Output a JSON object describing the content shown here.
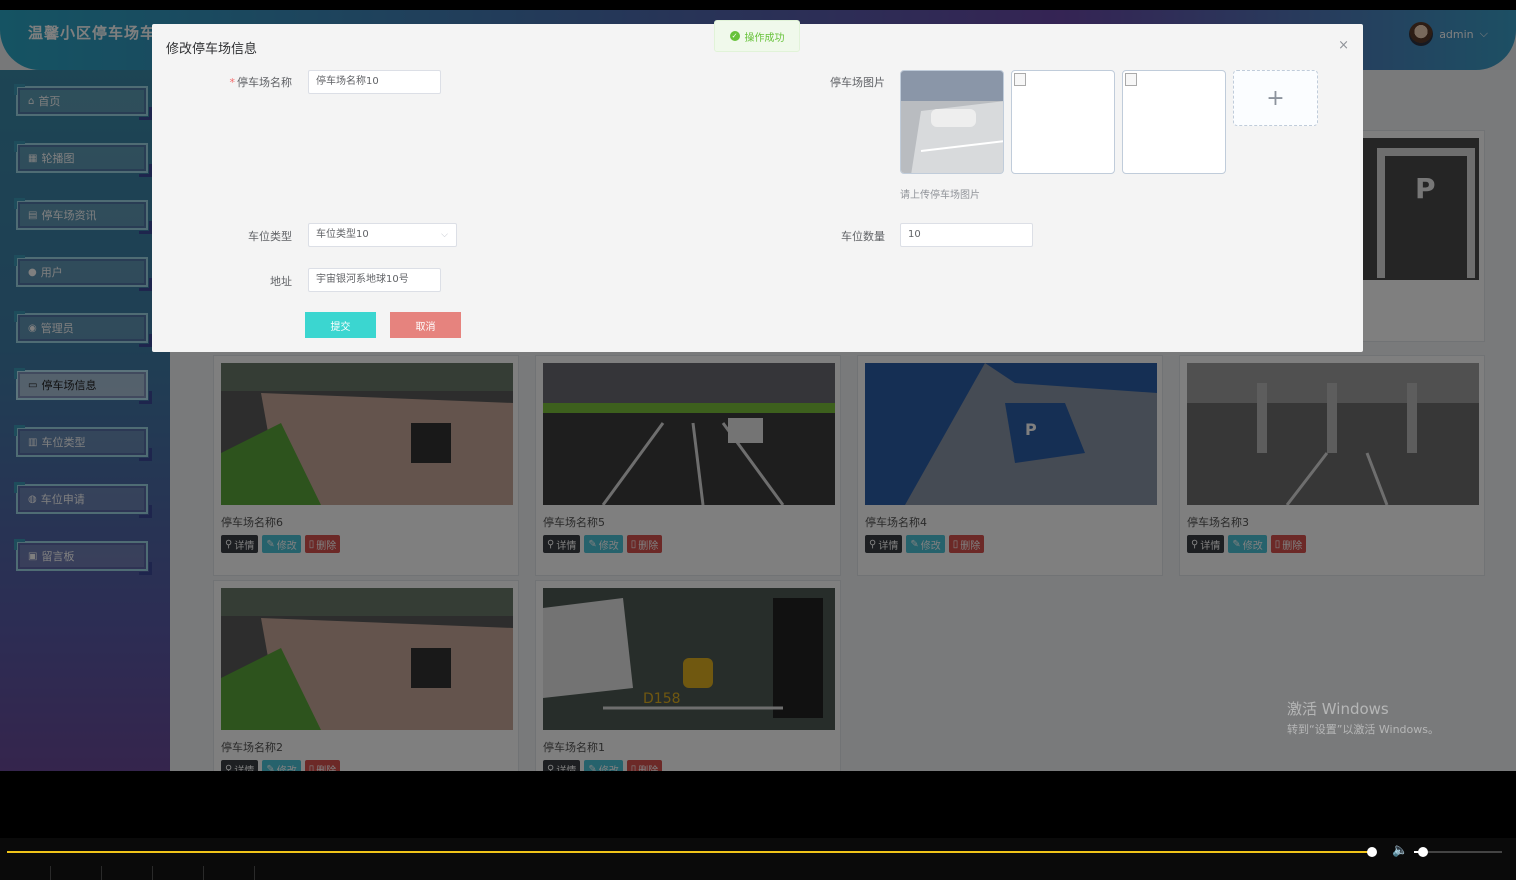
{
  "header": {
    "site_title": "温馨小区停车场车",
    "username": "admin",
    "dropdown_glyph": "⌵"
  },
  "sidebar": {
    "items": [
      {
        "label": "首页",
        "icon": "⌂"
      },
      {
        "label": "轮播图",
        "icon": "▦"
      },
      {
        "label": "停车场资讯",
        "icon": "▤"
      },
      {
        "label": "用户",
        "icon": "●"
      },
      {
        "label": "管理员",
        "icon": "◉"
      },
      {
        "label": "停车场信息",
        "icon": "▭"
      },
      {
        "label": "车位类型",
        "icon": "▥"
      },
      {
        "label": "车位申请",
        "icon": "◍"
      },
      {
        "label": "留言板",
        "icon": "▣"
      }
    ]
  },
  "cards": [
    {
      "name": "停车场名称6"
    },
    {
      "name": "停车场名称5"
    },
    {
      "name": "停车场名称4"
    },
    {
      "name": "停车场名称3"
    },
    {
      "name": "停车场名称2"
    },
    {
      "name": "停车场名称1"
    }
  ],
  "card_actions": {
    "detail": "详情",
    "edit": "修改",
    "delete": "删除"
  },
  "dialog": {
    "title": "修改停车场信息",
    "close_glyph": "×",
    "fields": {
      "name": {
        "label": "停车场名称",
        "value": "停车场名称10"
      },
      "images": {
        "label": "停车场图片",
        "tip": "请上传停车场图片",
        "add_glyph": "+"
      },
      "space_type": {
        "label": "车位类型",
        "value": "车位类型10"
      },
      "space_count": {
        "label": "车位数量",
        "value": "10"
      },
      "address": {
        "label": "地址",
        "value": "宇宙银河系地球10号"
      }
    },
    "submit": "提交",
    "cancel": "取消"
  },
  "toast": {
    "text": "操作成功",
    "glyph": "✓"
  },
  "watermark": {
    "line1": "激活 Windows",
    "line2": "转到“设置”以激活 Windows。"
  },
  "player": {
    "progress": 0.905,
    "volume": 0.05,
    "volume_glyph": "🔈"
  }
}
